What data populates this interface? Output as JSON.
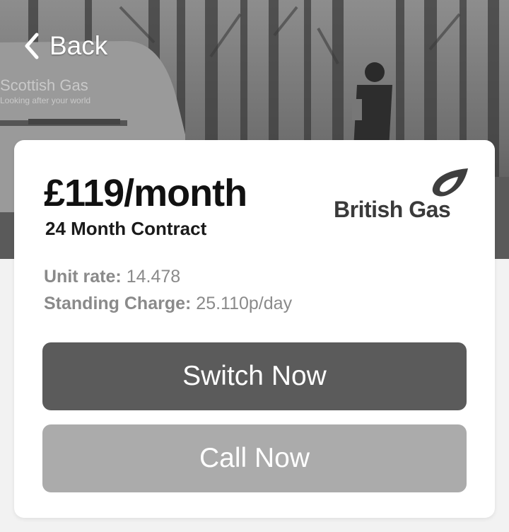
{
  "nav": {
    "back_label": "Back"
  },
  "hero": {
    "van_text_line1": "Scottish Gas",
    "van_text_line2": "Looking after your world"
  },
  "plan": {
    "price": "£119/month",
    "contract": "24 Month Contract",
    "unit_rate_label": "Unit rate:",
    "unit_rate_value": "14.478",
    "standing_charge_label": "Standing Charge:",
    "standing_charge_value": "25.110p/day"
  },
  "supplier": {
    "logo_text": "British Gas",
    "logo_icon": "flame-icon"
  },
  "actions": {
    "switch_label": "Switch Now",
    "call_label": "Call Now"
  },
  "colors": {
    "switch_button": "#5b5b5b",
    "call_button": "#ababab",
    "card_background": "#ffffff",
    "page_background": "#f2f2f2"
  }
}
